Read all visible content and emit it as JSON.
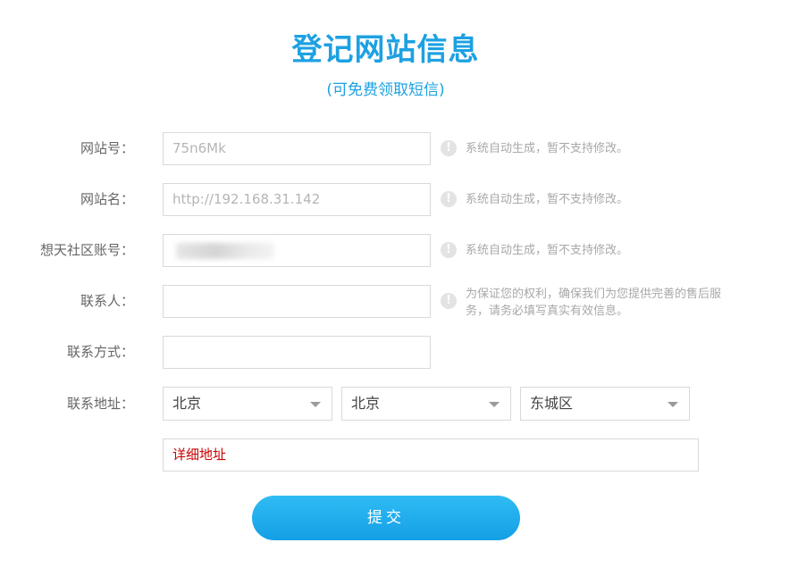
{
  "page": {
    "title": "登记网站信息",
    "subtitle": "(可免费领取短信)"
  },
  "form": {
    "site_id": {
      "label": "网站号：",
      "value": "75n6Mk",
      "hint": "系统自动生成，暂不支持修改。",
      "hint_icon": "info-icon"
    },
    "site_name": {
      "label": "网站名：",
      "value": "http://192.168.31.142",
      "hint": "系统自动生成，暂不支持修改。",
      "hint_icon": "info-icon"
    },
    "community_account": {
      "label": "想天社区账号：",
      "value": "",
      "hint": "系统自动生成，暂不支持修改。",
      "hint_icon": "info-icon"
    },
    "contact_person": {
      "label": "联系人：",
      "value": "",
      "hint_line1": "为保证您的权利，确保我们为您提供完善的售后服",
      "hint_line2": "务，请务必填写真实有效信息。",
      "hint_icon": "info-icon"
    },
    "contact_method": {
      "label": "联系方式：",
      "value": ""
    },
    "contact_address": {
      "label": "联系地址：",
      "province": "北京",
      "city": "北京",
      "district": "东城区",
      "detail_placeholder": "详细地址"
    },
    "submit_label": "提交"
  },
  "colors": {
    "accent": "#1da1e2",
    "button": "#20aeed",
    "placeholder_red": "#c80000",
    "hint_gray": "#a8a8a8"
  }
}
